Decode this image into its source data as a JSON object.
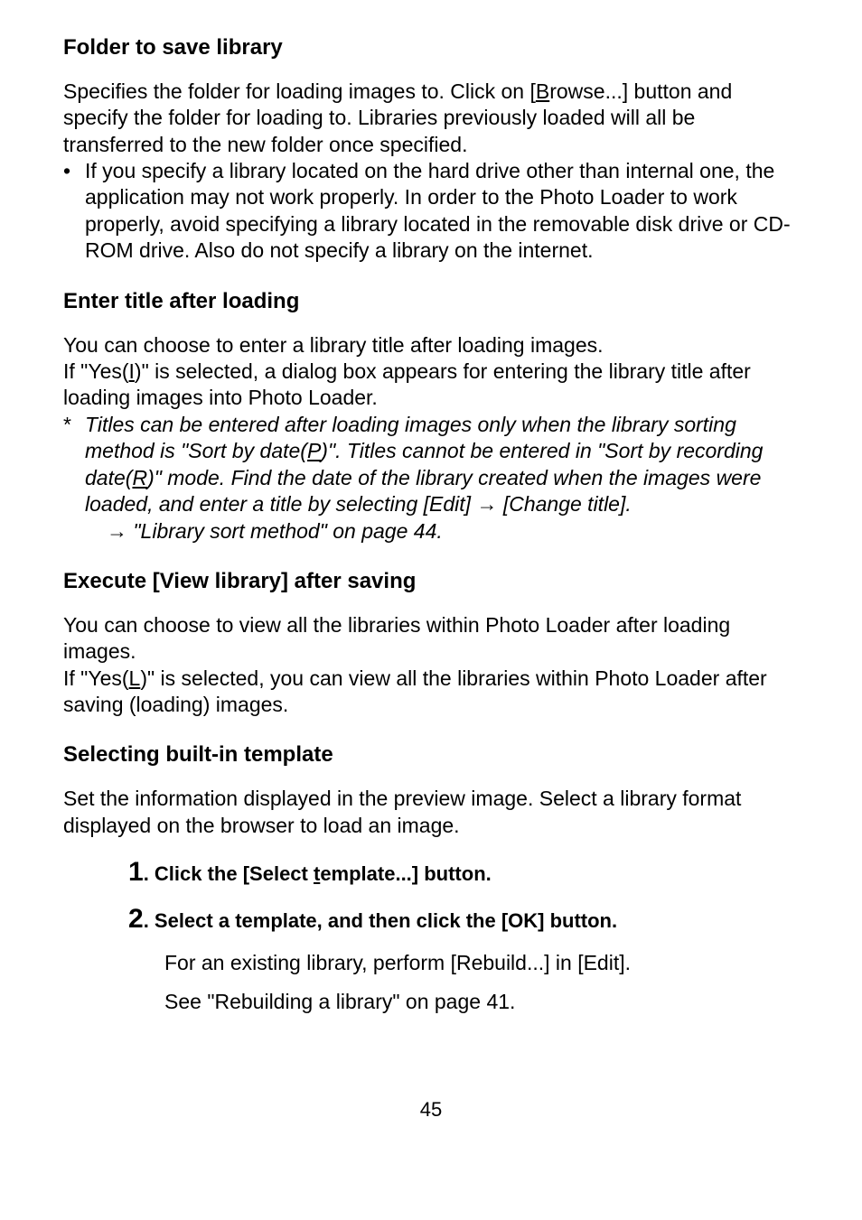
{
  "s1": {
    "heading": "Folder to save library",
    "p1a": "Specifies the folder for loading images to. Click on [",
    "p1b": "B",
    "p1c": "rowse...] button and specify the folder for loading to. Libraries previously loaded will all be transferred to the new folder once specified.",
    "bullet_marker": "•",
    "bullet_text": "If you specify a library located on the hard drive other than internal one, the application may not work properly. In order to the Photo Loader to work properly, avoid specifying a library located in the removable disk drive or CD-ROM drive. Also do not specify a library on the internet."
  },
  "s2": {
    "heading": "Enter title after loading",
    "p1": "You can choose to enter a library title after loading images.",
    "p2a": "If \"Yes(",
    "p2b": "I",
    "p2c": ")\" is selected, a dialog box appears for entering the library title after loading images into Photo Loader.",
    "note_marker": "*",
    "note_a": "Titles can be entered after loading images only when the library sorting method is \"Sort by date(",
    "note_b": "P",
    "note_c": ")\". Titles cannot be entered in \"Sort by recording date(",
    "note_d": "R",
    "note_e": ")\" mode. Find the date of the library created when the images were loaded, and enter a title by selecting [Edit] → [Change title].",
    "note_sub": " → \"Library sort method\" on page 44."
  },
  "s3": {
    "heading": "Execute [View library] after saving",
    "p1": "You can choose to view all the libraries within Photo Loader after loading images.",
    "p2a": "If \"Yes(",
    "p2b": "L",
    "p2c": ")\" is selected, you can view all the libraries within Photo Loader after saving (loading) images."
  },
  "s4": {
    "heading": "Selecting built-in template",
    "p1": "Set the information displayed in the preview image. Select a library format displayed on the browser to load an image.",
    "step1_num": "1",
    "step1_a": ". Click the [Select ",
    "step1_b": "t",
    "step1_c": "emplate...] button.",
    "step2_num": "2",
    "step2_text": ". Select a template, and then click the [OK] button.",
    "step2_detail1": "For an existing library, perform [Rebuild...] in [Edit].",
    "step2_detail2": "See \"Rebuilding a library\" on page 41."
  },
  "page_number": "45"
}
